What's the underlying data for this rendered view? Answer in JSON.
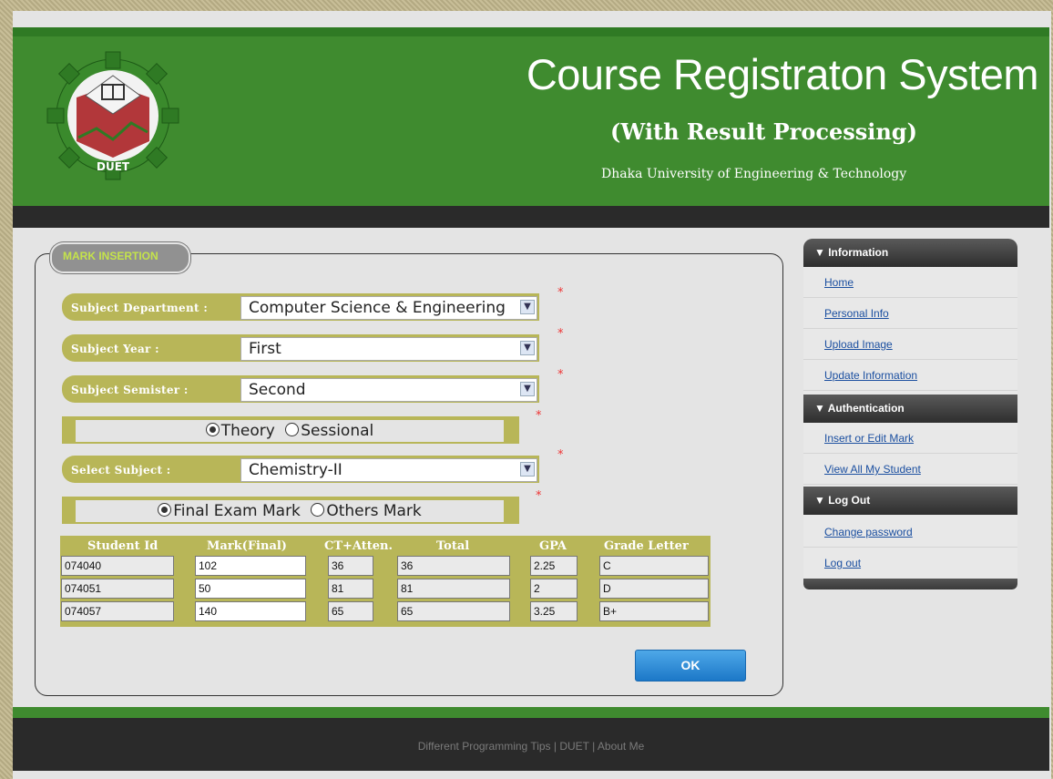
{
  "header": {
    "title": "Course Registraton System",
    "subtitle": "(With Result Processing)",
    "university": "Dhaka University of Engineering & Technology",
    "logo_text": "DUET"
  },
  "form": {
    "legend": "MARK INSERTION",
    "fields": [
      {
        "label": "Subject Department :",
        "value": "Computer Science & Engineering"
      },
      {
        "label": "Subject Year :",
        "value": "First"
      },
      {
        "label": "Subject Semister :",
        "value": "Second"
      },
      {
        "label": "Select Subject :",
        "value": "Chemistry-II"
      }
    ],
    "type_options": [
      {
        "label": "Theory",
        "selected": true
      },
      {
        "label": "Sessional",
        "selected": false
      }
    ],
    "mark_options": [
      {
        "label": "Final Exam Mark",
        "selected": true
      },
      {
        "label": "Others Mark",
        "selected": false
      }
    ],
    "required_marker": "*",
    "ok_label": "OK"
  },
  "table": {
    "headers": [
      "Student Id",
      "Mark(Final)",
      "CT+Atten.",
      "Total",
      "GPA",
      "Grade Letter"
    ],
    "rows": [
      [
        "074040",
        "102",
        "36",
        "36",
        "2.25",
        "C"
      ],
      [
        "074051",
        "50",
        "81",
        "81",
        "2",
        "D"
      ],
      [
        "074057",
        "140",
        "65",
        "65",
        "3.25",
        "B+"
      ]
    ]
  },
  "sidebar": {
    "sections": [
      {
        "title": "▼ Information",
        "items": [
          "Home",
          "Personal Info",
          "Upload Image",
          "Update Information"
        ]
      },
      {
        "title": "▼ Authentication",
        "items": [
          "Insert or Edit Mark",
          "View All My Student"
        ]
      },
      {
        "title": "▼ Log Out",
        "items": [
          "Change password",
          "Log out"
        ]
      }
    ]
  },
  "footer": {
    "text": "Different Programming Tips | DUET | About Me"
  },
  "colors": {
    "header_green": "#3f8b2f",
    "olive": "#b8b658",
    "legend_text": "#c4e34b",
    "ok_blue": "#1c78c8"
  }
}
